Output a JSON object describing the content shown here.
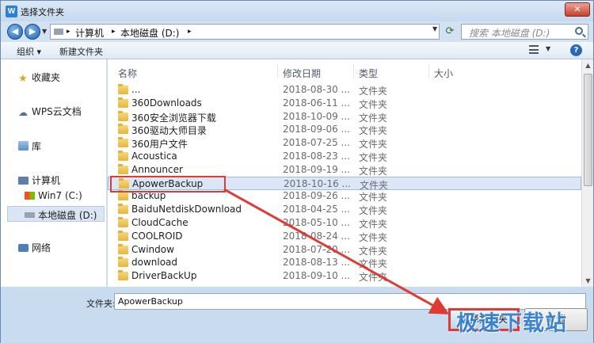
{
  "window": {
    "title": "选择文件夹",
    "close_label": "✕"
  },
  "address": {
    "crumbs": [
      "计算机",
      "本地磁盘 (D:)"
    ],
    "search_placeholder": "搜索 本地磁盘 (D:)"
  },
  "toolbar": {
    "organize": "组织 ▾",
    "new_folder": "新建文件夹"
  },
  "nav": {
    "favorites": "收藏夹",
    "wps_cloud": "WPS云文档",
    "libraries": "库",
    "computer": "计算机",
    "win7": "Win7 (C:)",
    "local_d": "本地磁盘 (D:)",
    "network": "网络"
  },
  "columns": {
    "name": "名称",
    "date": "修改日期",
    "type": "类型",
    "size": "大小"
  },
  "rows": [
    {
      "name": "...",
      "date": "2018-08-30 ...",
      "type": "文件夹"
    },
    {
      "name": "360Downloads",
      "date": "2018-06-11 ...",
      "type": "文件夹"
    },
    {
      "name": "360安全浏览器下载",
      "date": "2018-10-09 ...",
      "type": "文件夹"
    },
    {
      "name": "360驱动大师目录",
      "date": "2018-09-06 ...",
      "type": "文件夹"
    },
    {
      "name": "360用户文件",
      "date": "2018-07-25 ...",
      "type": "文件夹"
    },
    {
      "name": "Acoustica",
      "date": "2018-08-23 ...",
      "type": "文件夹"
    },
    {
      "name": "Announcer",
      "date": "2018-09-19 ...",
      "type": "文件夹"
    },
    {
      "name": "ApowerBackup",
      "date": "2018-10-16 ...",
      "type": "文件夹"
    },
    {
      "name": "backup",
      "date": "2018-09-26 ...",
      "type": "文件夹"
    },
    {
      "name": "BaiduNetdiskDownload",
      "date": "2018-04-25 ...",
      "type": "文件夹"
    },
    {
      "name": "CloudCache",
      "date": "2018-05-10 ...",
      "type": "文件夹"
    },
    {
      "name": "COOLROID",
      "date": "2018-08-24 ...",
      "type": "文件夹"
    },
    {
      "name": "Cwindow",
      "date": "2018-07-20 ...",
      "type": "文件夹"
    },
    {
      "name": "download",
      "date": "2018-08-13 ...",
      "type": "文件夹"
    },
    {
      "name": "DriverBackUp",
      "date": "2018-09-10 ...",
      "type": "文件夹"
    }
  ],
  "selected_row": 7,
  "bottom": {
    "folder_label": "文件夹:",
    "folder_value": "ApowerBackup",
    "select_button": "选择文件夹",
    "cancel_button": "取消"
  },
  "watermark": "极速下载站",
  "colors": {
    "accent": "#2a68b8",
    "annotation": "#e03a34",
    "selection": "#dbe7f6"
  }
}
